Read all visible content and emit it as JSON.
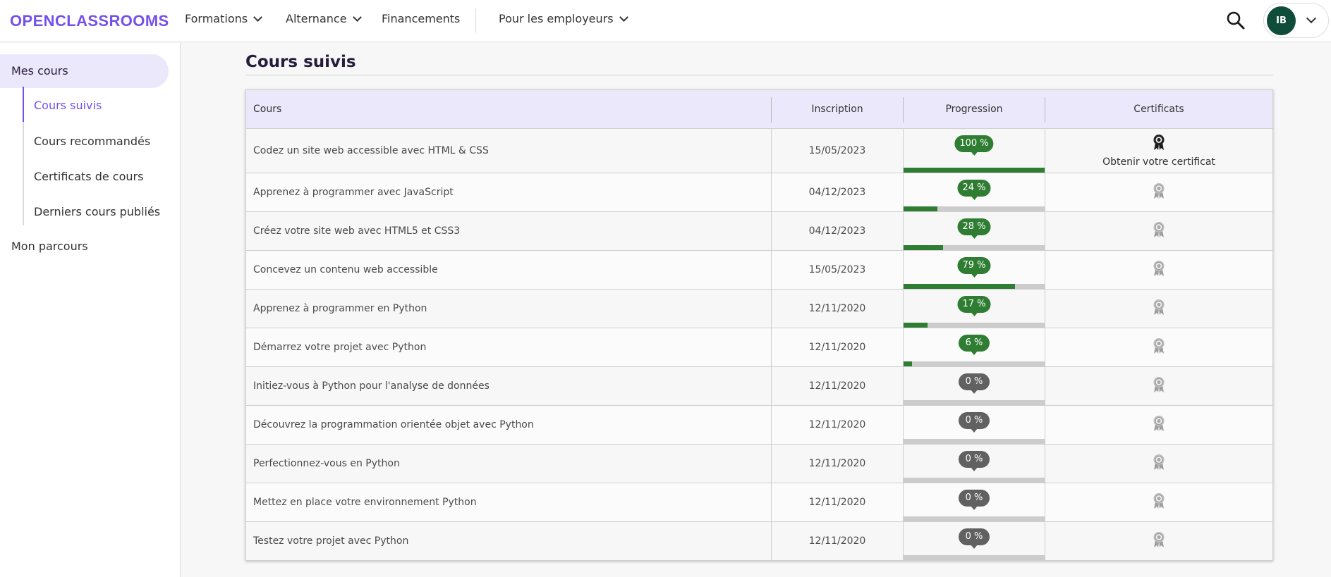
{
  "header": {
    "logo": "OPENCLASSROOMS",
    "nav": [
      {
        "label": "Formations",
        "dropdown": true
      },
      {
        "label": "Alternance",
        "dropdown": true
      },
      {
        "label": "Financements",
        "dropdown": false
      },
      {
        "label": "Pour les employeurs",
        "dropdown": true
      }
    ],
    "user_initials": "IB",
    "avatar_color": "#0f4c3a"
  },
  "sidebar": {
    "main_label": "Mes cours",
    "items": [
      {
        "label": "Cours suivis",
        "active": true
      },
      {
        "label": "Cours recommandés",
        "active": false
      },
      {
        "label": "Certificats de cours",
        "active": false
      },
      {
        "label": "Derniers cours publiés",
        "active": false
      }
    ],
    "parcours_label": "Mon parcours"
  },
  "main": {
    "title": "Cours suivis",
    "table": {
      "headers": [
        "Cours",
        "Inscription",
        "Progression",
        "Certificats"
      ],
      "rows": [
        {
          "course": "Codez un site web accessible avec HTML & CSS",
          "date": "15/05/2023",
          "progress": 100,
          "progress_label": "100 %",
          "certificate": "Obtenir votre certificat"
        },
        {
          "course": "Apprenez à programmer avec JavaScript",
          "date": "04/12/2023",
          "progress": 24,
          "progress_label": "24 %",
          "certificate": ""
        },
        {
          "course": "Créez votre site web avec HTML5 et CSS3",
          "date": "04/12/2023",
          "progress": 28,
          "progress_label": "28 %",
          "certificate": ""
        },
        {
          "course": "Concevez un contenu web accessible",
          "date": "15/05/2023",
          "progress": 79,
          "progress_label": "79 %",
          "certificate": ""
        },
        {
          "course": "Apprenez à programmer en Python",
          "date": "12/11/2020",
          "progress": 17,
          "progress_label": "17 %",
          "certificate": ""
        },
        {
          "course": "Démarrez votre projet avec Python",
          "date": "12/11/2020",
          "progress": 6,
          "progress_label": "6 %",
          "certificate": ""
        },
        {
          "course": "Initiez-vous à Python pour l'analyse de données",
          "date": "12/11/2020",
          "progress": 0,
          "progress_label": "0 %",
          "certificate": ""
        },
        {
          "course": "Découvrez la programmation orientée objet avec Python",
          "date": "12/11/2020",
          "progress": 0,
          "progress_label": "0 %",
          "certificate": ""
        },
        {
          "course": "Perfectionnez-vous en Python",
          "date": "12/11/2020",
          "progress": 0,
          "progress_label": "0 %",
          "certificate": ""
        },
        {
          "course": "Mettez en place votre environnement Python",
          "date": "12/11/2020",
          "progress": 0,
          "progress_label": "0 %",
          "certificate": ""
        },
        {
          "course": "Testez votre projet avec Python",
          "date": "12/11/2020",
          "progress": 0,
          "progress_label": "0 %",
          "certificate": ""
        }
      ]
    }
  },
  "colors": {
    "brand": "#7451eb",
    "progress_green": "#2e7d32",
    "progress_gray": "#616161",
    "header_row_bg": "#ece8fb"
  },
  "icons": {
    "search": "search-icon",
    "certificate_earned": "award-ribbon-icon",
    "certificate_locked": "award-ribbon-gray-icon"
  }
}
